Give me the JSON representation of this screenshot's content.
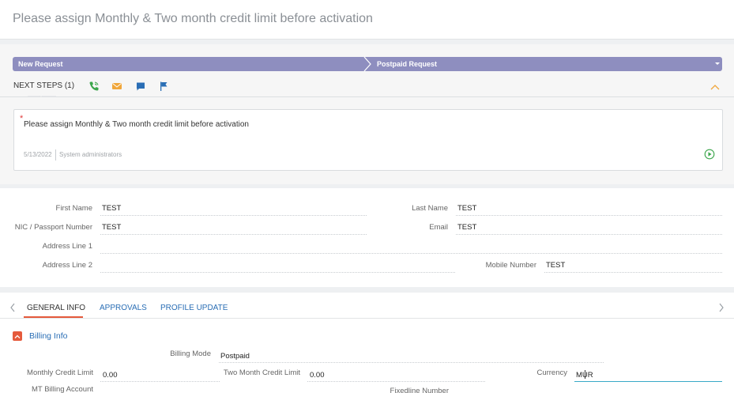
{
  "header": {
    "title": "Please assign Monthly & Two month credit limit before activation"
  },
  "stages": [
    {
      "label": "New Request"
    },
    {
      "label": "Postpaid Request"
    }
  ],
  "next_steps": {
    "label": "NEXT STEPS (1)",
    "icons": [
      "phone-icon",
      "email-icon",
      "chat-icon",
      "flag-icon"
    ]
  },
  "task": {
    "text": "Please assign Monthly & Two month credit limit before activation",
    "date": "5/13/2022",
    "owner": "System administrators"
  },
  "profile": {
    "first_name": {
      "label": "First Name",
      "value": "TEST"
    },
    "last_name": {
      "label": "Last Name",
      "value": "TEST"
    },
    "nic": {
      "label": "NIC / Passport Number",
      "value": "TEST"
    },
    "email": {
      "label": "Email",
      "value": "TEST"
    },
    "address1": {
      "label": "Address Line 1",
      "value": ""
    },
    "address2": {
      "label": "Address Line 2",
      "value": ""
    },
    "mobile": {
      "label": "Mobile Number",
      "value": "TEST"
    }
  },
  "tabs": [
    {
      "label": "GENERAL INFO",
      "active": true
    },
    {
      "label": "APPROVALS",
      "active": false
    },
    {
      "label": "PROFILE UPDATE",
      "active": false
    }
  ],
  "billing": {
    "group_title": "Billing Info",
    "billing_mode": {
      "label": "Billing Mode",
      "value": "Postpaid"
    },
    "monthly_limit": {
      "label": "Monthly Credit Limit",
      "value": "0.00"
    },
    "two_month_limit": {
      "label": "Two Month Credit Limit",
      "value": "0.00"
    },
    "currency": {
      "label": "Currency",
      "value": "MUR"
    },
    "mt_billing_label": "MT Billing Account",
    "fixedline_label": "Fixedline Number"
  },
  "colors": {
    "accent": "#e55a3c",
    "link": "#2a6eb5",
    "stage_bar": "#8e8ebf",
    "focus": "#3aa9c8"
  }
}
